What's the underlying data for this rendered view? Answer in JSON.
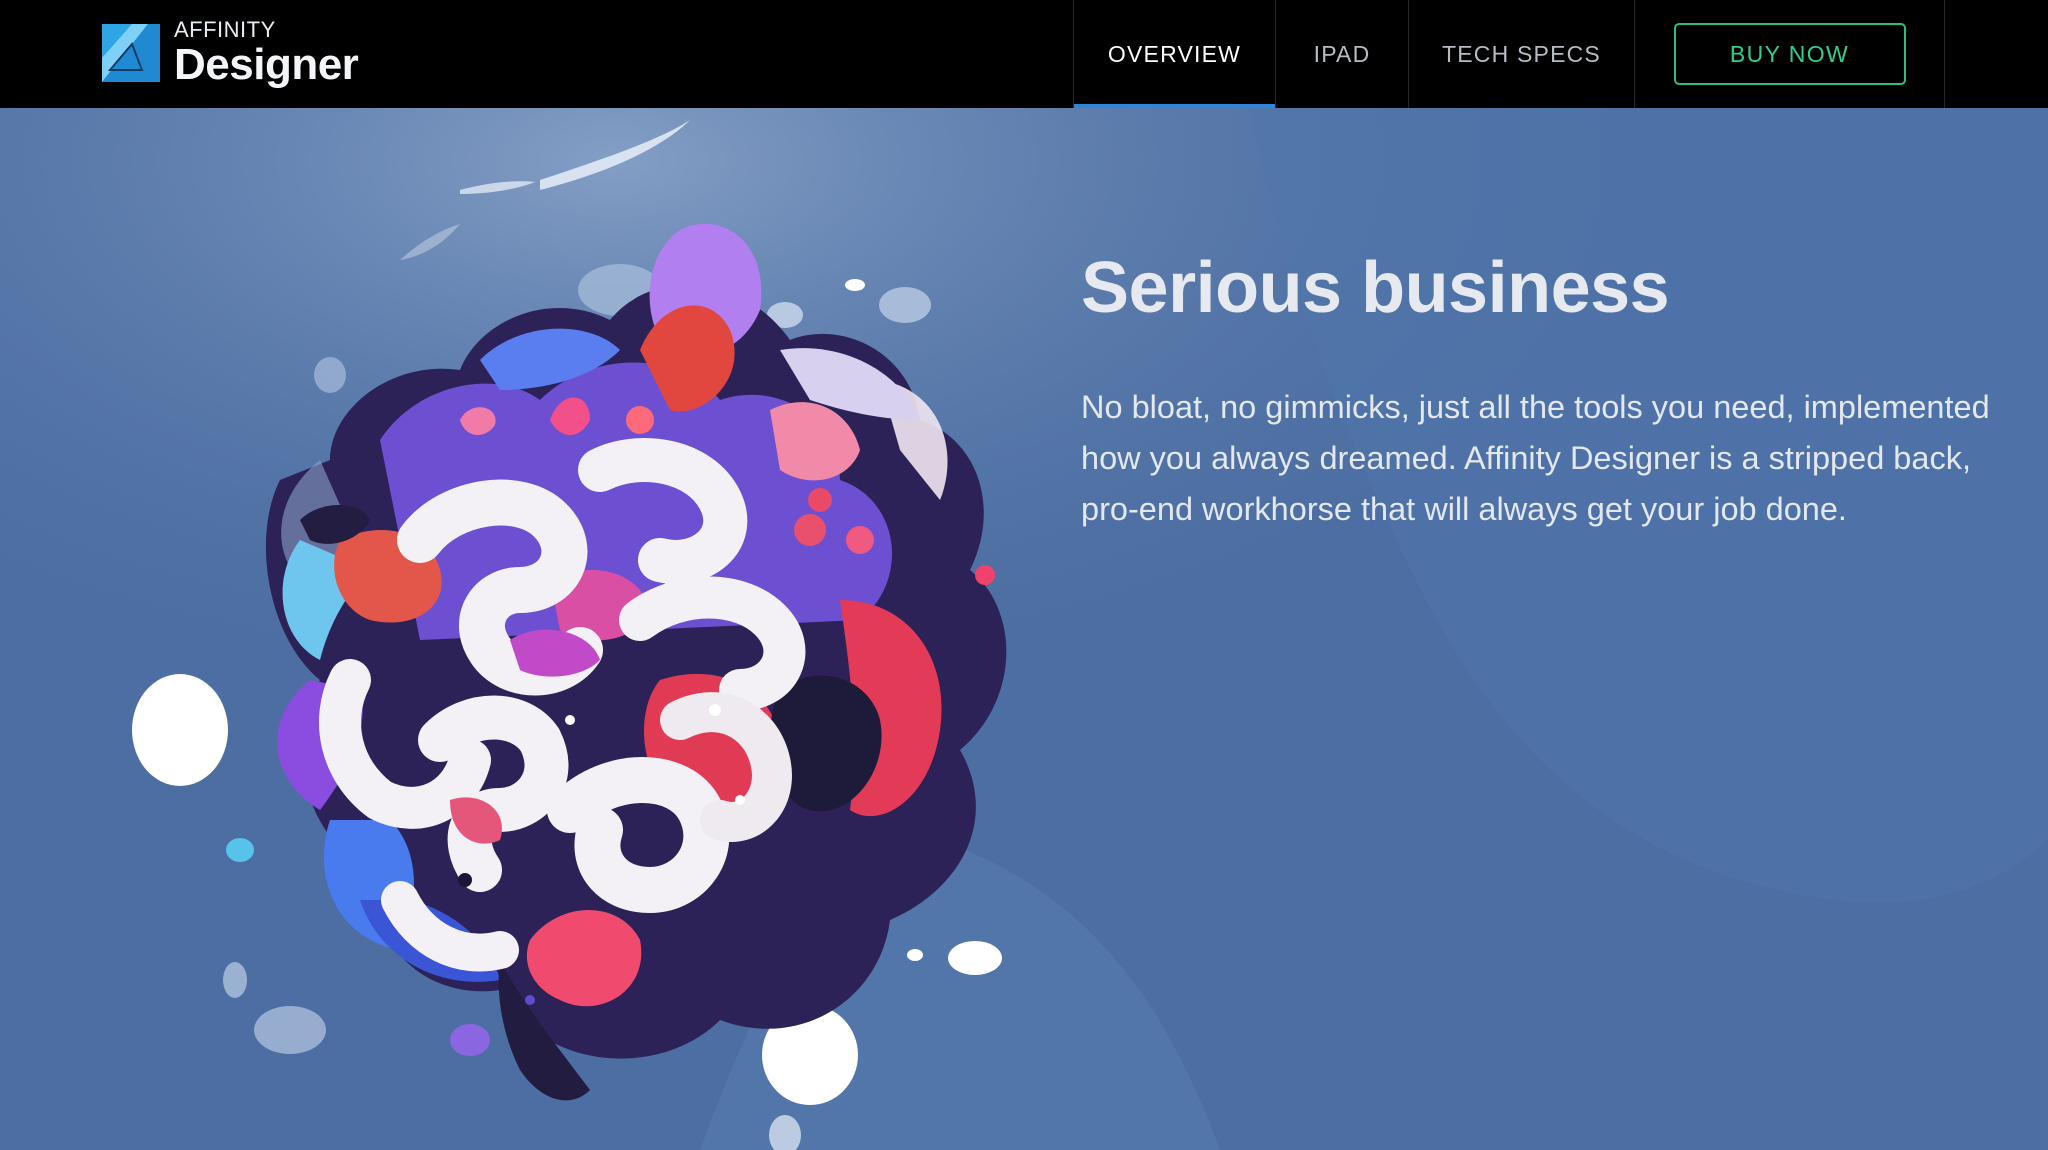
{
  "brand": {
    "product_line": "AFFINITY",
    "product_name": "Designer",
    "logo_icon": "affinity-designer-logo-icon"
  },
  "nav": {
    "items": [
      {
        "label": "OVERVIEW",
        "active": true
      },
      {
        "label": "IPAD",
        "active": false
      },
      {
        "label": "TECH SPECS",
        "active": false
      }
    ],
    "cta_label": "BUY NOW"
  },
  "hero": {
    "headline": "Serious business",
    "body": "No bloat, no gimmicks, just all the tools you need, implemented how you always dreamed. Affinity Designer is a stripped back, pro-end workhorse that will always get your job done.",
    "illustration": "abstract-colorful-blob-illustration"
  },
  "colors": {
    "nav_background": "#000000",
    "hero_background": "#4b6da1",
    "active_underline": "#2f86d6",
    "cta_green": "#2fd08a",
    "logo_blue": "#2ea6e6"
  }
}
